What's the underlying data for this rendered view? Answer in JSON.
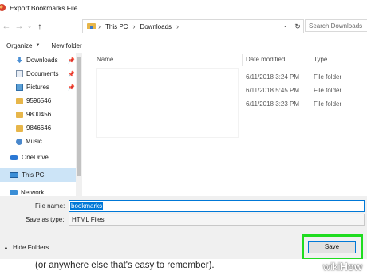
{
  "window": {
    "title": "Export Bookmarks File"
  },
  "address": {
    "crumbs": [
      "This PC",
      "Downloads"
    ],
    "search_placeholder": "Search Downloads"
  },
  "toolbar": {
    "organize": "Organize",
    "new_folder": "New folder"
  },
  "nav": {
    "items": [
      {
        "label": "Downloads",
        "icon": "download-icon",
        "pinned": true
      },
      {
        "label": "Documents",
        "icon": "document-icon",
        "pinned": true
      },
      {
        "label": "Pictures",
        "icon": "pictures-icon",
        "pinned": true
      },
      {
        "label": "9596546",
        "icon": "folder-icon"
      },
      {
        "label": "9800456",
        "icon": "folder-icon"
      },
      {
        "label": "9846646",
        "icon": "folder-icon"
      },
      {
        "label": "Music",
        "icon": "music-icon"
      },
      {
        "label": "OneDrive",
        "icon": "onedrive-icon"
      },
      {
        "label": "This PC",
        "icon": "pc-icon",
        "selected": true
      },
      {
        "label": "Network",
        "icon": "network-icon"
      }
    ]
  },
  "files": {
    "columns": {
      "name": "Name",
      "date": "Date modified",
      "type": "Type"
    },
    "rows": [
      {
        "date": "6/11/2018 3:24 PM",
        "type": "File folder"
      },
      {
        "date": "6/11/2018 5:45 PM",
        "type": "File folder"
      },
      {
        "date": "6/11/2018 3:23 PM",
        "type": "File folder"
      }
    ]
  },
  "form": {
    "filename_label": "File name:",
    "filename_value": "bookmarks",
    "saveas_label": "Save as type:",
    "saveas_value": "HTML Files"
  },
  "footer": {
    "hide_folders": "Hide Folders",
    "save": "Save"
  },
  "caption": {
    "text": "(or anywhere else that's easy to remember).",
    "brand_wiki": "wiki",
    "brand_how": "How"
  },
  "colors": {
    "accent": "#0078d7",
    "highlight": "#1fdc1f",
    "selected_nav": "#cce4f7"
  }
}
